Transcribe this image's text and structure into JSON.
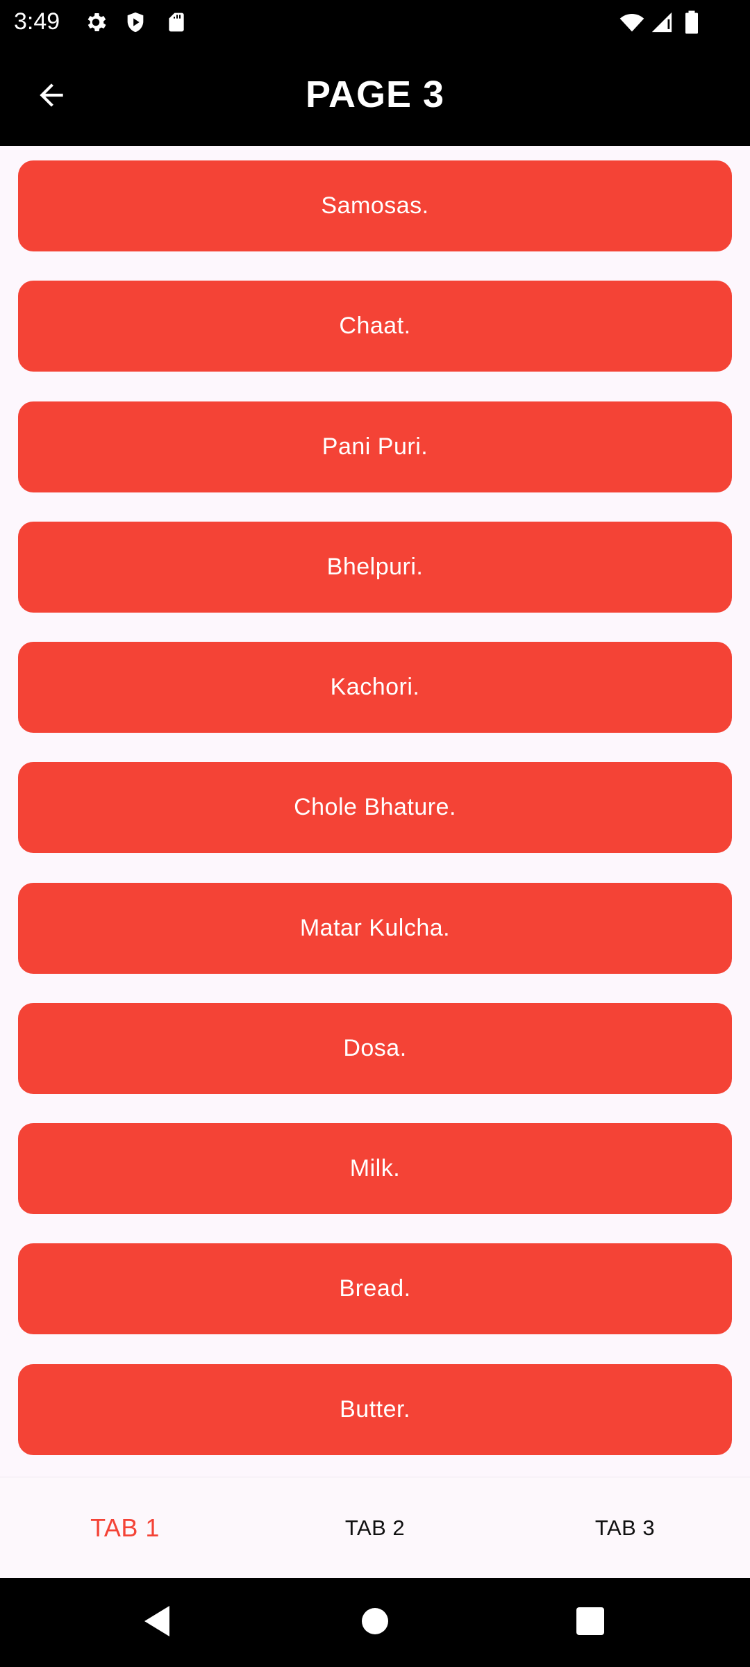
{
  "status_bar": {
    "time": "3:49",
    "left_icons": [
      "gear-icon",
      "shield-icon",
      "sd-card-icon"
    ],
    "right_icons": [
      "wifi-icon",
      "signal-icon",
      "battery-icon"
    ]
  },
  "app_bar": {
    "title": "PAGE 3",
    "back_icon": "arrow-left-icon"
  },
  "colors": {
    "button": "#f44336",
    "button_text": "#ffffff",
    "active_tab": "#f44336",
    "bar": "#000000",
    "background": "#fdf7fd"
  },
  "items": [
    {
      "label": "Samosas."
    },
    {
      "label": "Chaat."
    },
    {
      "label": "Pani Puri."
    },
    {
      "label": "Bhelpuri."
    },
    {
      "label": "Kachori."
    },
    {
      "label": "Chole Bhature."
    },
    {
      "label": "Matar Kulcha."
    },
    {
      "label": "Dosa."
    },
    {
      "label": "Milk."
    },
    {
      "label": "Bread."
    },
    {
      "label": "Butter."
    }
  ],
  "tabs": [
    {
      "label": "TAB 1",
      "active": true
    },
    {
      "label": "TAB 2",
      "active": false
    },
    {
      "label": "TAB 3",
      "active": false
    }
  ],
  "nav_bar": {
    "back": "triangle-back-icon",
    "home": "circle-home-icon",
    "recents": "square-recents-icon"
  }
}
